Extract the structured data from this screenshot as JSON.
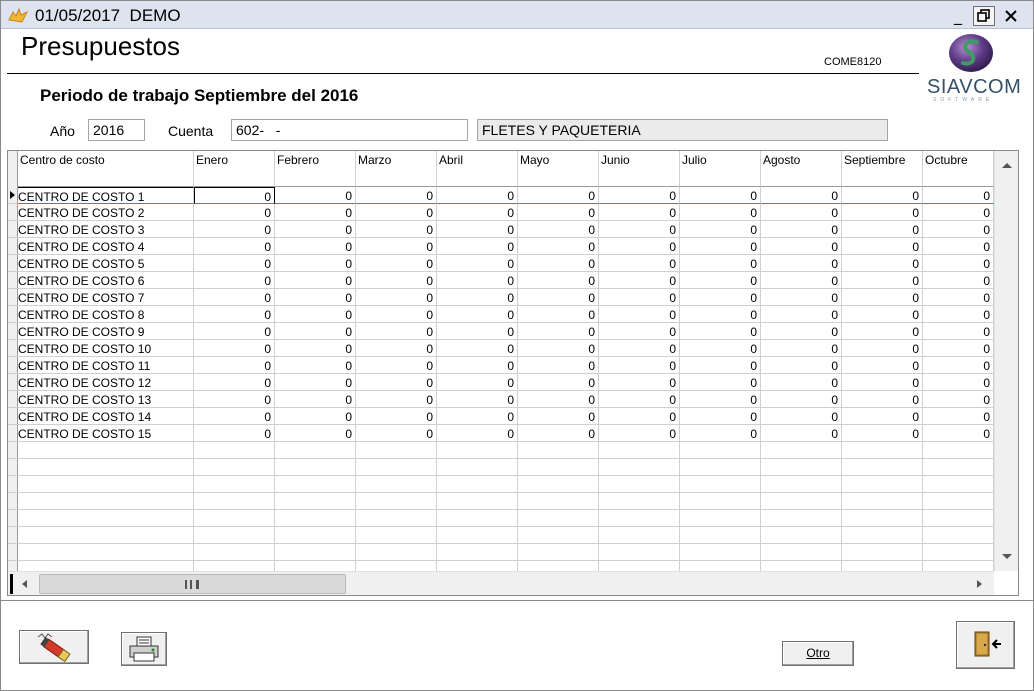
{
  "window": {
    "title_date": "01/05/2017",
    "title_mode": "DEMO"
  },
  "header": {
    "title": "Presupuestos",
    "form_code": "COME8120",
    "logo_text": "SIAVCOM",
    "logo_subtext": "SOFTWARE"
  },
  "period": {
    "label": "Periodo de trabajo Septiembre del 2016"
  },
  "filters": {
    "year_label": "Año",
    "year_value": "2016",
    "account_label": "Cuenta",
    "account_value": "602-   -",
    "account_description": "FLETES Y PAQUETERIA"
  },
  "grid": {
    "columns": [
      "Centro de costo",
      "Enero",
      "Febrero",
      "Marzo",
      "Abril",
      "Mayo",
      "Junio",
      "Julio",
      "Agosto",
      "Septiembre",
      "Octubre"
    ],
    "rows": [
      {
        "name": "CENTRO DE COSTO 1",
        "values": [
          "0",
          "0",
          "0",
          "0",
          "0",
          "0",
          "0",
          "0",
          "0",
          "0"
        ]
      },
      {
        "name": "CENTRO DE COSTO 2",
        "values": [
          "0",
          "0",
          "0",
          "0",
          "0",
          "0",
          "0",
          "0",
          "0",
          "0"
        ]
      },
      {
        "name": "CENTRO DE COSTO 3",
        "values": [
          "0",
          "0",
          "0",
          "0",
          "0",
          "0",
          "0",
          "0",
          "0",
          "0"
        ]
      },
      {
        "name": "CENTRO DE COSTO 4",
        "values": [
          "0",
          "0",
          "0",
          "0",
          "0",
          "0",
          "0",
          "0",
          "0",
          "0"
        ]
      },
      {
        "name": "CENTRO DE COSTO 5",
        "values": [
          "0",
          "0",
          "0",
          "0",
          "0",
          "0",
          "0",
          "0",
          "0",
          "0"
        ]
      },
      {
        "name": "CENTRO DE COSTO 6",
        "values": [
          "0",
          "0",
          "0",
          "0",
          "0",
          "0",
          "0",
          "0",
          "0",
          "0"
        ]
      },
      {
        "name": "CENTRO DE COSTO 7",
        "values": [
          "0",
          "0",
          "0",
          "0",
          "0",
          "0",
          "0",
          "0",
          "0",
          "0"
        ]
      },
      {
        "name": "CENTRO DE COSTO 8",
        "values": [
          "0",
          "0",
          "0",
          "0",
          "0",
          "0",
          "0",
          "0",
          "0",
          "0"
        ]
      },
      {
        "name": "CENTRO DE COSTO 9",
        "values": [
          "0",
          "0",
          "0",
          "0",
          "0",
          "0",
          "0",
          "0",
          "0",
          "0"
        ]
      },
      {
        "name": "CENTRO DE COSTO 10",
        "values": [
          "0",
          "0",
          "0",
          "0",
          "0",
          "0",
          "0",
          "0",
          "0",
          "0"
        ]
      },
      {
        "name": "CENTRO DE COSTO 11",
        "values": [
          "0",
          "0",
          "0",
          "0",
          "0",
          "0",
          "0",
          "0",
          "0",
          "0"
        ]
      },
      {
        "name": "CENTRO DE COSTO 12",
        "values": [
          "0",
          "0",
          "0",
          "0",
          "0",
          "0",
          "0",
          "0",
          "0",
          "0"
        ]
      },
      {
        "name": "CENTRO DE COSTO 13",
        "values": [
          "0",
          "0",
          "0",
          "0",
          "0",
          "0",
          "0",
          "0",
          "0",
          "0"
        ]
      },
      {
        "name": "CENTRO DE COSTO 14",
        "values": [
          "0",
          "0",
          "0",
          "0",
          "0",
          "0",
          "0",
          "0",
          "0",
          "0"
        ]
      },
      {
        "name": "CENTRO DE COSTO 15",
        "values": [
          "0",
          "0",
          "0",
          "0",
          "0",
          "0",
          "0",
          "0",
          "0",
          "0"
        ]
      }
    ],
    "empty_row_count": 8
  },
  "footer": {
    "erase_icon": "eraser-icon",
    "print_icon": "printer-icon",
    "other_label": "Otro",
    "exit_icon": "exit-door-icon"
  },
  "colors": {
    "titlebar": "#dde4f0",
    "selection_line": "#3c7fd3",
    "logo_text": "#35506a"
  }
}
